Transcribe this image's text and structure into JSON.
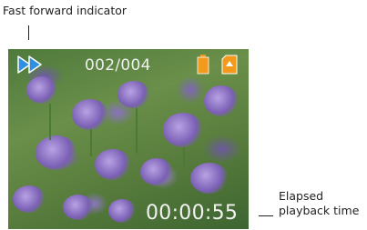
{
  "callouts": {
    "top_label": "Fast forward indicator",
    "right_label_line1": "Elapsed",
    "right_label_line2": "playback time"
  },
  "screen": {
    "counter": "002/004",
    "elapsed_time": "00:00:55",
    "icons": [
      "fast-forward-icon",
      "battery-icon",
      "memory-card-icon"
    ],
    "colors": {
      "fast_forward": "#2f8fe0",
      "battery": "#f39a1c",
      "card": "#f39a1c"
    }
  }
}
